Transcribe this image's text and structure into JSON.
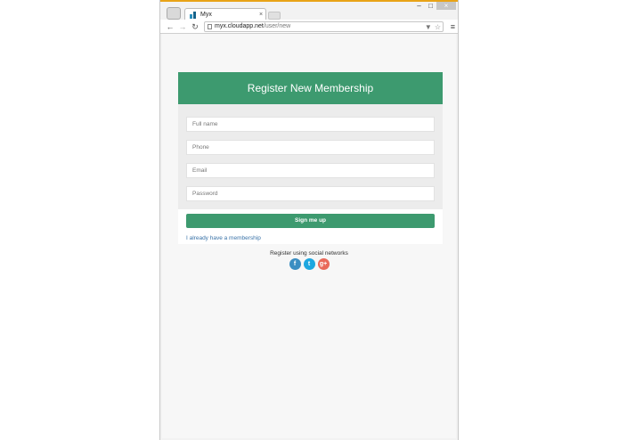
{
  "browser": {
    "tab_title": "Myx",
    "tab_close": "×",
    "url_domain": "myx.cloudapp.net",
    "url_path": "/user/new",
    "win_min": "–",
    "win_max": "□",
    "win_close": "×",
    "back": "←",
    "forward": "→",
    "reload": "↻",
    "star": "☆",
    "menu": "≡",
    "filter": "▼"
  },
  "page": {
    "header_title": "Register New Membership",
    "fields": {
      "full_name_placeholder": "Full name",
      "phone_placeholder": "Phone",
      "email_placeholder": "Email",
      "password_placeholder": "Password"
    },
    "signup_label": "Sign me up",
    "member_link": "I already have a membership",
    "social_label": "Register using social networks",
    "social": {
      "facebook": "f",
      "twitter": "t",
      "google": "g+"
    }
  },
  "colors": {
    "brand_green": "#3d9a6f",
    "link_blue": "#3a73a8",
    "facebook": "#3b8ec2",
    "twitter": "#1da7e0",
    "google": "#e9695a"
  }
}
